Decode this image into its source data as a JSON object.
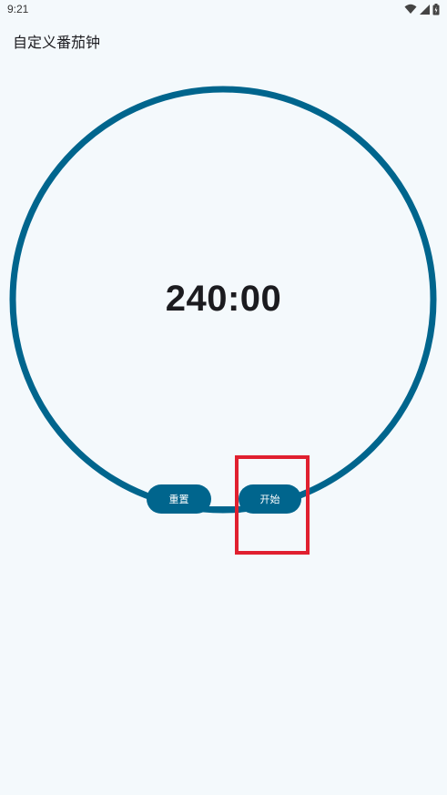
{
  "status_bar": {
    "time": "9:21",
    "icons": [
      "wifi-icon",
      "signal-icon",
      "battery-icon"
    ]
  },
  "app_bar": {
    "title": "自定义番茄钟"
  },
  "timer": {
    "display": "240:00",
    "ring_color": "#00658d"
  },
  "controls": {
    "reset_label": "重置",
    "start_label": "开始"
  },
  "colors": {
    "background": "#f4f9fc",
    "accent": "#00658d",
    "highlight": "#e0202f"
  }
}
